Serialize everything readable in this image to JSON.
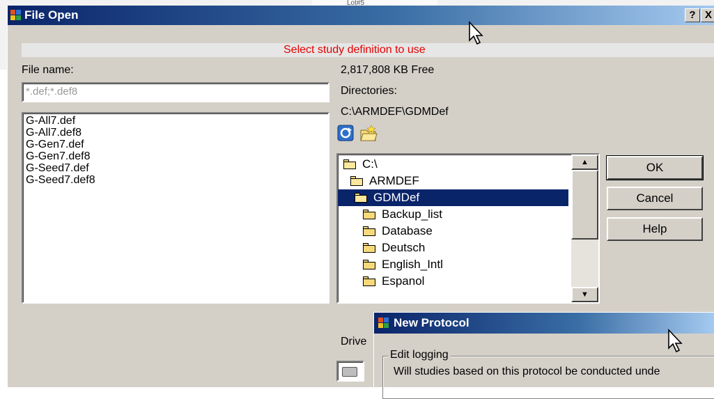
{
  "background": {
    "fragment_text": "Lot#5"
  },
  "file_open_dialog": {
    "title": "File Open",
    "title_buttons": {
      "help": "?",
      "close": "X"
    },
    "banner": "Select study definition to use",
    "file_name_label": "File name:",
    "file_name_value": "*.def;*.def8",
    "files": [
      "G-All7.def",
      "G-All7.def8",
      "G-Gen7.def",
      "G-Gen7.def8",
      "G-Seed7.def",
      "G-Seed7.def8"
    ],
    "free_space": "2,817,808 KB Free",
    "directories_label": "Directories:",
    "current_path": "C:\\ARMDEF\\GDMDef",
    "directories": [
      {
        "name": "C:\\",
        "state": "open"
      },
      {
        "name": "ARMDEF",
        "state": "open"
      },
      {
        "name": "GDMDef",
        "state": "open",
        "selected": true
      },
      {
        "name": "Backup_list",
        "state": "closed"
      },
      {
        "name": "Database",
        "state": "closed"
      },
      {
        "name": "Deutsch",
        "state": "closed"
      },
      {
        "name": "English_Intl",
        "state": "closed"
      },
      {
        "name": "Espanol",
        "state": "closed"
      }
    ],
    "buttons": {
      "ok": "OK",
      "cancel": "Cancel",
      "help": "Help"
    },
    "drives_label": "Drive",
    "icons": [
      "refresh-icon",
      "new-folder-icon",
      "drive-icon"
    ]
  },
  "new_protocol_dialog": {
    "title": "New Protocol",
    "group_label": "Edit logging",
    "question": "Will studies based on this protocol be conducted unde"
  },
  "colors": {
    "title_start": "#0a246a",
    "title_end": "#a6caf0",
    "dialog_face": "#d4d0c8",
    "banner_text": "#e60000",
    "selection": "#0a246a"
  }
}
